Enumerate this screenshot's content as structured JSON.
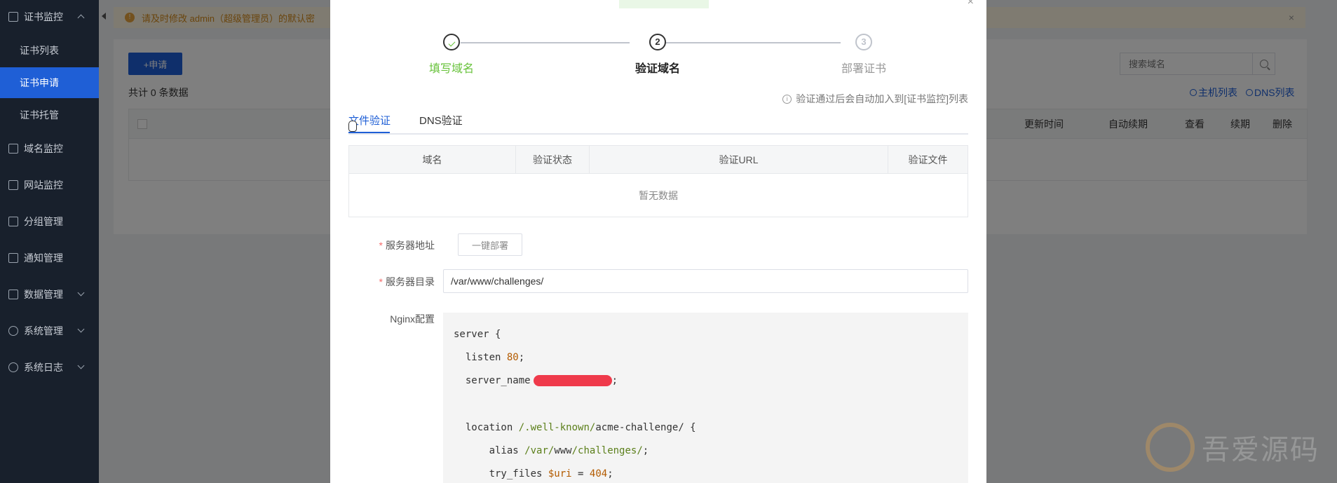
{
  "sidebar": {
    "groups": [
      {
        "label": "证书监控",
        "icon": "document-icon",
        "expanded": true
      },
      {
        "label": "域名监控",
        "icon": "database-icon"
      },
      {
        "label": "网站监控",
        "icon": "monitor-icon"
      },
      {
        "label": "分组管理",
        "icon": "folder-icon"
      },
      {
        "label": "通知管理",
        "icon": "mail-icon"
      },
      {
        "label": "数据管理",
        "icon": "briefcase-icon"
      },
      {
        "label": "系统管理",
        "icon": "gear-icon"
      },
      {
        "label": "系统日志",
        "icon": "clock-icon"
      }
    ],
    "sub_items": [
      {
        "label": "证书列表"
      },
      {
        "label": "证书申请",
        "active": true
      },
      {
        "label": "证书托管"
      }
    ]
  },
  "notice": {
    "text": "请及时修改 admin（超级管理员）的默认密"
  },
  "page": {
    "apply_button": "+申请",
    "total_text": "共计 0 条数据",
    "search_placeholder": "搜索域名",
    "links": {
      "host_list": "主机列表",
      "dns_list": "DNS列表"
    },
    "table_headers": [
      "更新时间",
      "自动续期",
      "查看",
      "续期",
      "删除"
    ]
  },
  "modal": {
    "steps": [
      {
        "title": "填写域名",
        "status": "done"
      },
      {
        "number": "2",
        "title": "验证域名",
        "status": "current"
      },
      {
        "number": "3",
        "title": "部署证书",
        "status": "wait"
      }
    ],
    "verify_note": "验证通过后会自动加入到[证书监控]列表",
    "tabs": [
      {
        "label": "文件验证",
        "active": true
      },
      {
        "label": "DNS验证"
      }
    ],
    "table": {
      "headers": [
        "域名",
        "验证状态",
        "验证URL",
        "验证文件"
      ],
      "empty_text": "暂无数据"
    },
    "form": {
      "server_address_label": "服务器地址",
      "deploy_button": "一键部署",
      "server_dir_label": "服务器目录",
      "server_dir_value": "/var/www/challenges/",
      "nginx_label": "Nginx配置"
    },
    "code": {
      "line1": "server {",
      "listen_kw": "listen",
      "listen_port": "80",
      "server_name_kw": "server_name",
      "location_kw": "location",
      "location_path": "/.well-known/",
      "location_rest": "acme-challenge/ {",
      "alias_kw": "alias",
      "alias_path1": "/var/",
      "alias_path2": "www",
      "alias_path3": "/challenges/",
      "try_kw": "try_files",
      "try_var": "$uri",
      "try_eq": " = ",
      "try_code": "404"
    }
  },
  "watermark": {
    "text": "吾爱源码"
  },
  "colors": {
    "primary": "#1f5fd6",
    "success": "#67c23a",
    "sidebar_bg": "#18202c",
    "required": "#f56c6c"
  }
}
